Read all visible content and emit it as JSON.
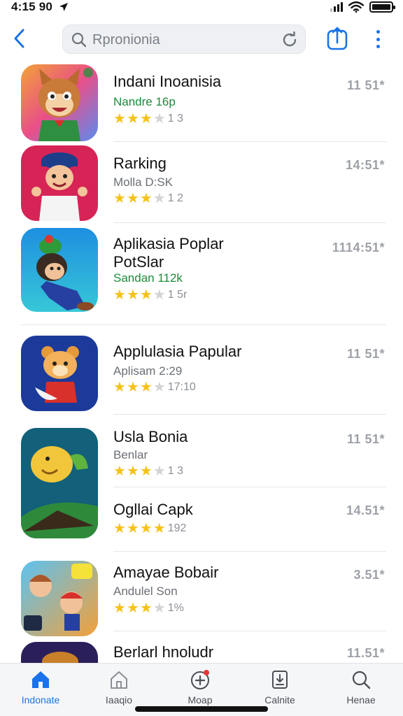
{
  "status_bar": {
    "time": "4:15 90",
    "location_icon": "location-arrow-icon",
    "signal_icon": "signal-icon",
    "wifi_icon": "wifi-icon",
    "battery_icon": "battery-icon"
  },
  "top_bar": {
    "back_icon": "chevron-left-icon",
    "search": {
      "placeholder": "Rpronionia",
      "search_icon": "search-icon",
      "refresh_icon": "refresh-icon"
    },
    "share_icon": "share-icon",
    "more_icon": "more-vertical-icon"
  },
  "colors": {
    "accent": "#1a73e8",
    "star": "#f5c21a",
    "subtitle_green": "#1d8a3a"
  },
  "apps": [
    {
      "name": "Indani Inoanisia",
      "subtitle": "Nandre 16p",
      "subtitle_style": "green",
      "stars": 3,
      "rating_count": "1 3",
      "price": "11 51*"
    },
    {
      "name": "Rarking",
      "subtitle": "Molla D:SK",
      "subtitle_style": "gray",
      "stars": 3,
      "rating_count": "1 2",
      "price": "14:51*"
    },
    {
      "name": "Aplikasia Poplar",
      "name_line2": "PotSlar",
      "subtitle": "Sandan 112k",
      "subtitle_style": "green",
      "stars": 2.5,
      "rating_count": "1 5r",
      "price": "1114:51*"
    },
    {
      "name": "Applulasia Papular",
      "subtitle": "Aplisam 2:29",
      "subtitle_style": "gray",
      "stars": 3,
      "rating_count": "17:10",
      "price": "11 51*"
    },
    {
      "name": "Usla Bonia",
      "subtitle": "Benlar",
      "subtitle_style": "gray",
      "stars": 3,
      "rating_count": "1 3",
      "price": "11 51*"
    },
    {
      "name": "Ogllai Capk",
      "subtitle": "",
      "subtitle_style": "gray",
      "stars": 4,
      "rating_count": "192",
      "price": "14.51*"
    },
    {
      "name": "Amayae Bobair",
      "subtitle": "Andulel Son",
      "subtitle_style": "gray",
      "stars": 3,
      "rating_count": "1%",
      "price": "3.51*"
    },
    {
      "name": "Berlarl hnoludr",
      "subtitle": "",
      "subtitle_style": "gray",
      "stars": 0,
      "rating_count": "",
      "price": "11.51*"
    }
  ],
  "tabs": [
    {
      "label": "Indonate",
      "icon": "home-icon",
      "active": true
    },
    {
      "label": "Iaaqio",
      "icon": "home-outline-icon",
      "active": false
    },
    {
      "label": "Moap",
      "icon": "plus-circle-icon",
      "active": false
    },
    {
      "label": "Calnite",
      "icon": "download-icon",
      "active": false
    },
    {
      "label": "Henae",
      "icon": "search-icon",
      "active": false
    }
  ]
}
